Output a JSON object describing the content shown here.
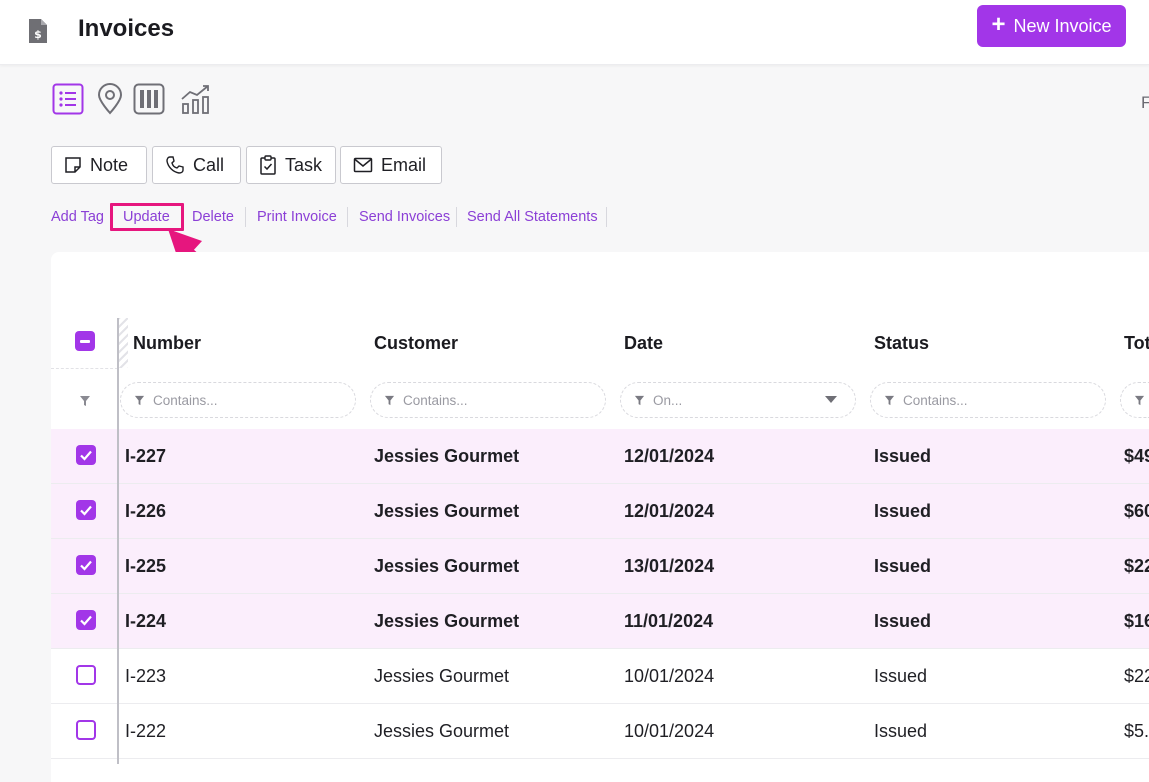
{
  "header": {
    "title": "Invoices",
    "new_button": "New Invoice",
    "clipped_text": "F"
  },
  "view_icons": [
    "list-view-icon",
    "map-pin-icon",
    "kanban-icon",
    "chart-icon"
  ],
  "activity_buttons": [
    {
      "label": "Note",
      "icon": "note-icon"
    },
    {
      "label": "Call",
      "icon": "phone-icon"
    },
    {
      "label": "Task",
      "icon": "clipboard-check-icon"
    },
    {
      "label": "Email",
      "icon": "envelope-icon"
    }
  ],
  "bulk_links": [
    "Add Tag",
    "Update",
    "Delete",
    "Print Invoice",
    "Send Invoices",
    "Send All Statements"
  ],
  "highlighted_link": "Update",
  "table": {
    "columns": [
      "Number",
      "Customer",
      "Date",
      "Status",
      "Tot"
    ],
    "filters": [
      "Contains...",
      "Contains...",
      "On...",
      "Contains..."
    ],
    "rows": [
      {
        "number": "I-227",
        "customer": "Jessies Gourmet",
        "date": "12/01/2024",
        "status": "Issued",
        "total": "$49",
        "selected": true
      },
      {
        "number": "I-226",
        "customer": "Jessies Gourmet",
        "date": "12/01/2024",
        "status": "Issued",
        "total": "$60",
        "selected": true
      },
      {
        "number": "I-225",
        "customer": "Jessies Gourmet",
        "date": "13/01/2024",
        "status": "Issued",
        "total": "$22",
        "selected": true
      },
      {
        "number": "I-224",
        "customer": "Jessies Gourmet",
        "date": "11/01/2024",
        "status": "Issued",
        "total": "$16",
        "selected": true
      },
      {
        "number": "I-223",
        "customer": "Jessies Gourmet",
        "date": "10/01/2024",
        "status": "Issued",
        "total": "$22",
        "selected": false
      },
      {
        "number": "I-222",
        "customer": "Jessies Gourmet",
        "date": "10/01/2024",
        "status": "Issued",
        "total": "$5.",
        "selected": false
      }
    ]
  },
  "colors": {
    "accent": "#a236e8",
    "highlight": "#e6167e",
    "selected_row": "#fbeefc"
  }
}
